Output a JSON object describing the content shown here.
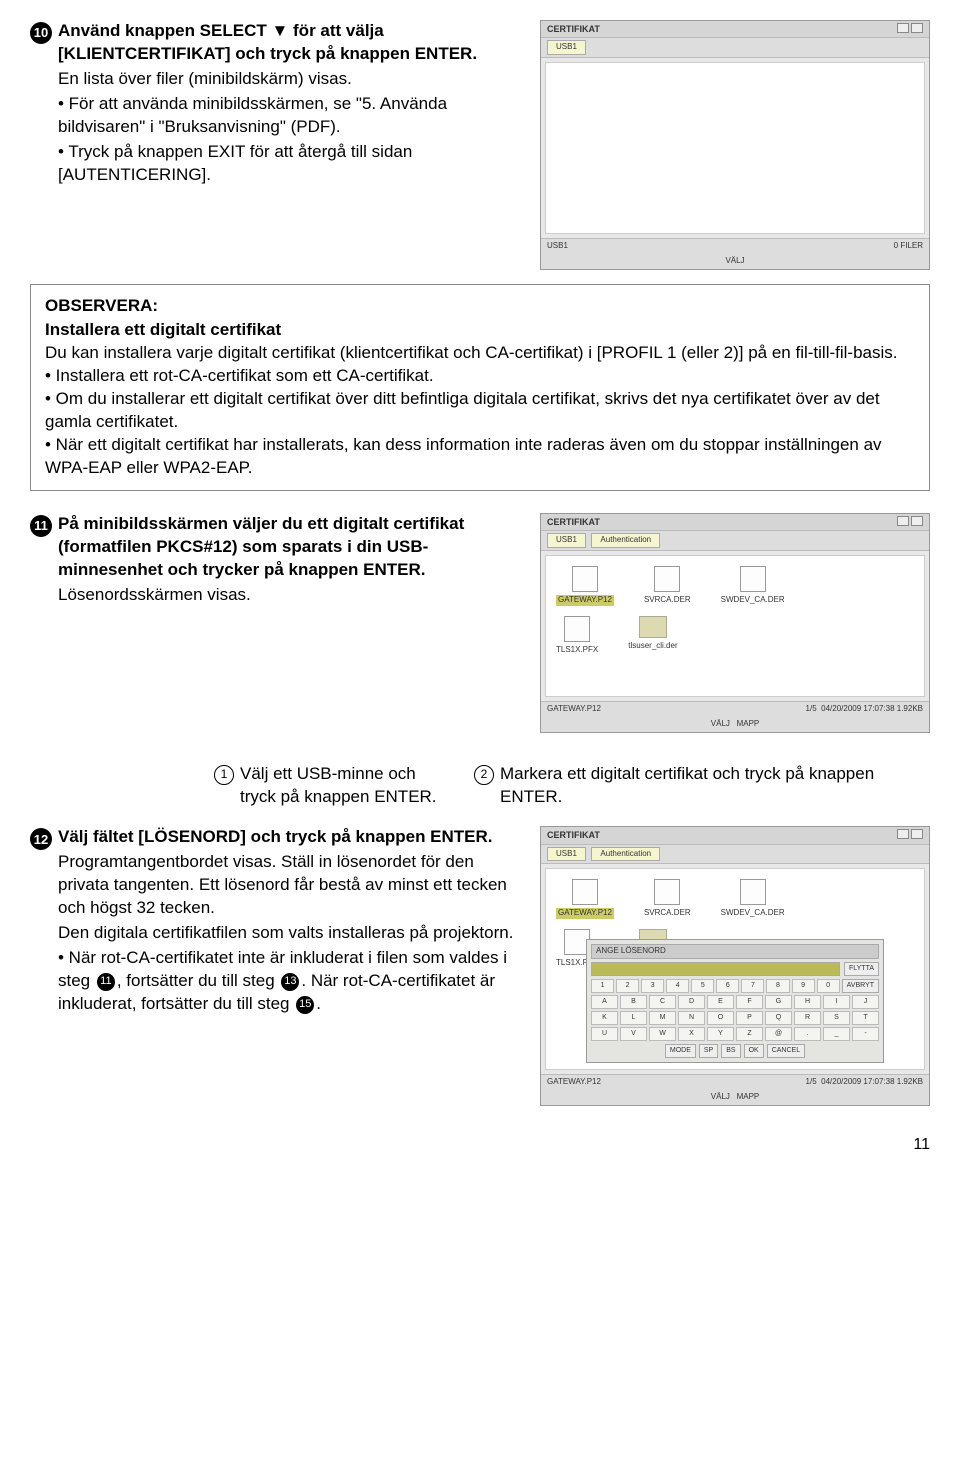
{
  "step10": {
    "num": "10",
    "main": "Använd knappen SELECT ▼ för att välja [KLIENTCERTIFIKAT] och tryck på knappen ENTER.",
    "sub": "En lista över filer (minibildskärm) visas.",
    "b1": "• För att använda minibildsskärmen, se \"5. Använda bildvisaren\" i \"Bruksanvisning\" (PDF).",
    "b2": "• Tryck på knappen EXIT för att återgå till sidan [AUTENTICERING]."
  },
  "note": {
    "title": "OBSERVERA:",
    "subtitle": "Installera ett digitalt certifikat",
    "p1": "Du kan installera varje digitalt certifikat (klientcertifikat och CA-certifikat) i [PROFIL 1 (eller 2)] på en fil-till-fil-basis.",
    "b1": "• Installera ett rot-CA-certifikat som ett CA-certifikat.",
    "b2": "• Om du installerar ett digitalt certifikat över ditt befintliga digitala certifikat, skrivs det nya certifikatet över av det gamla certifikatet.",
    "b3": "• När ett digitalt certifikat har installerats, kan dess information inte raderas även om du stoppar inställningen av WPA-EAP eller WPA2-EAP."
  },
  "step11": {
    "num": "11",
    "main": "På minibildsskärmen väljer du ett digitalt certifikat (formatfilen PKCS#12) som sparats i din USB-minnesenhet och trycker på knappen ENTER.",
    "sub": "Lösenordsskärmen visas."
  },
  "cap1": {
    "num": "1",
    "text": "Välj ett USB-minne och tryck på knappen ENTER."
  },
  "cap2": {
    "num": "2",
    "text": "Markera ett digitalt certifikat och tryck på knappen ENTER."
  },
  "step12": {
    "num": "12",
    "main": "Välj fältet [LÖSENORD] och tryck på knappen ENTER.",
    "p1": "Programtangentbordet visas. Ställ in lösenordet för den privata tangenten. Ett lösenord får bestå av minst ett tecken och högst 32 tecken.",
    "p2": "Den digitala certifikatfilen som valts installeras på projektorn.",
    "b1a": "• När rot-CA-certifikatet inte är inkluderat i filen som valdes i steg ",
    "b1b": ", fortsätter du till steg ",
    "b1c": ". När rot-CA-certifikatet är inkluderat, fortsätter du till steg ",
    "b1d": ".",
    "n11": "11",
    "n13": "13",
    "n15": "15"
  },
  "mock": {
    "title": "CERTIFIKAT",
    "usb": "USB1",
    "status_left": "USB1",
    "status_right": "0 FILER",
    "valj": "VÄLJ",
    "files": {
      "f1": "GATEWAY.P12",
      "f2": "SVRCA.DER",
      "f3": "SWDEV_CA.DER",
      "f4": "TLS1X.PFX",
      "f5": "tlsuser_cli.der"
    },
    "bar_left": "GATEWAY.P12",
    "bar_mid": "1/5",
    "bar_right": "04/20/2009 17:07:38  1.92KB",
    "mapp": "MAPP",
    "kbd_title": "ANGE LÖSENORD",
    "btns": {
      "flytta": "FLYTTA",
      "avbryt": "AVBRYT",
      "ok": "OK",
      "cancel": "CANCEL",
      "mode": "MODE",
      "sp": "SP",
      "bs": "BS"
    },
    "auth_tab": "Authentication"
  },
  "page": "11"
}
